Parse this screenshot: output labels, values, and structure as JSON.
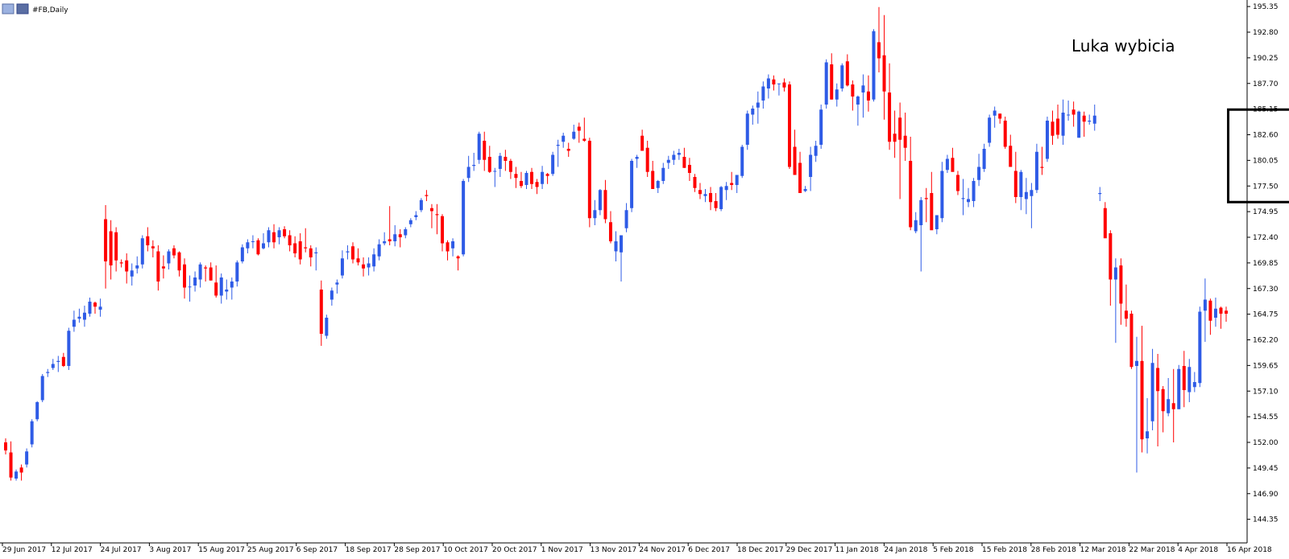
{
  "window": {
    "title": "#FB,Daily"
  },
  "colors": {
    "bull": "#2E5BE6",
    "bear": "#FF0000",
    "axis": "#000000",
    "highlight": "#000000"
  },
  "annotation": {
    "text": "Luka wybicia"
  },
  "chart_data": {
    "type": "candlestick",
    "symbol": "#FB",
    "timeframe": "Daily",
    "ylim": [
      142.0,
      196.0
    ],
    "y_ticks": [
      "195.35",
      "192.80",
      "190.25",
      "187.70",
      "185.15",
      "182.60",
      "180.05",
      "177.50",
      "174.95",
      "172.40",
      "169.85",
      "167.30",
      "164.75",
      "162.20",
      "159.65",
      "157.10",
      "154.55",
      "152.00",
      "149.45",
      "146.90",
      "144.35"
    ],
    "x_ticks": [
      "29 Jun 2017",
      "12 Jul 2017",
      "24 Jul 2017",
      "3 Aug 2017",
      "15 Aug 2017",
      "25 Aug 2017",
      "6 Sep 2017",
      "18 Sep 2017",
      "28 Sep 2017",
      "10 Oct 2017",
      "20 Oct 2017",
      "1 Nov 2017",
      "13 Nov 2017",
      "24 Nov 2017",
      "6 Dec 2017",
      "18 Dec 2017",
      "29 Dec 2017",
      "11 Jan 2018",
      "24 Jan 2018",
      "5 Feb 2018",
      "15 Feb 2018",
      "28 Feb 2018",
      "12 Mar 2018",
      "22 Mar 2018",
      "4 Apr 2018",
      "16 Apr 2018"
    ],
    "candles_ohlc": [
      [
        152.0,
        152.4,
        150.8,
        151.2
      ],
      [
        151.0,
        152.1,
        148.2,
        148.5
      ],
      [
        148.4,
        149.3,
        148.2,
        149.1
      ],
      [
        149.5,
        149.8,
        148.2,
        149.0
      ],
      [
        149.8,
        151.4,
        149.5,
        151.1
      ],
      [
        151.8,
        154.3,
        151.5,
        154.1
      ],
      [
        154.3,
        156.1,
        154.1,
        156.0
      ],
      [
        156.2,
        158.8,
        156.0,
        158.6
      ],
      [
        158.9,
        159.3,
        158.5,
        159.0
      ],
      [
        159.4,
        160.3,
        159.2,
        159.8
      ],
      [
        160.0,
        160.6,
        159.0,
        160.1
      ],
      [
        160.5,
        160.9,
        159.5,
        159.6
      ],
      [
        159.6,
        163.4,
        159.2,
        163.1
      ],
      [
        163.5,
        165.1,
        163.0,
        164.2
      ],
      [
        164.3,
        165.3,
        163.9,
        164.5
      ],
      [
        164.2,
        165.6,
        163.5,
        164.9
      ],
      [
        164.8,
        166.4,
        164.5,
        166.0
      ],
      [
        165.9,
        166.0,
        164.8,
        165.5
      ],
      [
        165.2,
        166.3,
        164.5,
        165.5
      ],
      [
        174.2,
        175.6,
        167.3,
        170.0
      ],
      [
        173.0,
        174.1,
        168.2,
        169.6
      ],
      [
        172.9,
        173.4,
        169.0,
        170.1
      ],
      [
        169.9,
        170.2,
        169.4,
        169.8
      ],
      [
        170.1,
        170.8,
        167.8,
        169.0
      ],
      [
        168.5,
        169.8,
        167.6,
        169.1
      ],
      [
        169.3,
        170.5,
        168.8,
        169.6
      ],
      [
        169.7,
        172.6,
        169.3,
        172.3
      ],
      [
        172.5,
        173.4,
        171.0,
        171.6
      ],
      [
        171.5,
        172.1,
        170.4,
        171.3
      ],
      [
        171.0,
        171.6,
        167.1,
        168.0
      ],
      [
        169.5,
        170.6,
        168.3,
        169.3
      ],
      [
        169.8,
        171.2,
        169.2,
        171.0
      ],
      [
        171.3,
        171.6,
        170.3,
        170.6
      ],
      [
        170.9,
        171.0,
        168.5,
        169.1
      ],
      [
        169.7,
        170.3,
        166.3,
        167.4
      ],
      [
        167.5,
        168.6,
        166.0,
        167.5
      ],
      [
        167.6,
        169.0,
        167.0,
        168.4
      ],
      [
        168.2,
        169.9,
        167.4,
        169.7
      ],
      [
        169.4,
        169.6,
        168.0,
        169.3
      ],
      [
        169.4,
        169.9,
        168.1,
        168.1
      ],
      [
        167.9,
        169.6,
        166.4,
        166.6
      ],
      [
        166.6,
        168.8,
        165.8,
        168.4
      ],
      [
        167.0,
        168.2,
        166.2,
        167.2
      ],
      [
        167.4,
        168.4,
        166.2,
        168.0
      ],
      [
        168.0,
        170.1,
        167.5,
        169.9
      ],
      [
        170.0,
        171.7,
        169.8,
        171.4
      ],
      [
        171.3,
        172.2,
        170.8,
        171.9
      ],
      [
        172.0,
        172.6,
        171.3,
        172.0
      ],
      [
        172.1,
        172.3,
        170.6,
        170.7
      ],
      [
        171.3,
        172.8,
        171.2,
        171.8
      ],
      [
        171.9,
        173.4,
        171.4,
        173.1
      ],
      [
        172.9,
        173.7,
        171.3,
        171.9
      ],
      [
        172.4,
        173.4,
        171.7,
        173.1
      ],
      [
        173.2,
        173.5,
        172.3,
        172.5
      ],
      [
        172.6,
        173.1,
        171.0,
        171.6
      ],
      [
        171.8,
        172.5,
        170.4,
        170.8
      ],
      [
        172.0,
        172.8,
        169.7,
        170.2
      ],
      [
        171.4,
        173.3,
        170.9,
        171.3
      ],
      [
        171.3,
        171.6,
        169.5,
        170.4
      ],
      [
        170.8,
        171.4,
        169.1,
        170.9
      ],
      [
        167.2,
        168.1,
        161.6,
        162.8
      ],
      [
        162.6,
        164.7,
        162.3,
        164.4
      ],
      [
        166.2,
        167.4,
        165.6,
        167.1
      ],
      [
        167.7,
        168.2,
        166.8,
        167.9
      ],
      [
        168.6,
        171.1,
        168.3,
        170.3
      ],
      [
        170.9,
        171.6,
        170.2,
        171.0
      ],
      [
        171.5,
        171.9,
        169.8,
        170.2
      ],
      [
        170.3,
        171.3,
        169.6,
        169.9
      ],
      [
        169.7,
        170.4,
        168.5,
        169.3
      ],
      [
        169.4,
        170.4,
        168.6,
        169.8
      ],
      [
        169.5,
        171.3,
        169.0,
        170.7
      ],
      [
        170.5,
        172.2,
        170.1,
        171.7
      ],
      [
        171.8,
        172.9,
        171.6,
        172.0
      ],
      [
        172.2,
        175.5,
        171.6,
        172.0
      ],
      [
        172.0,
        173.6,
        171.5,
        172.7
      ],
      [
        172.7,
        173.2,
        171.4,
        172.4
      ],
      [
        172.6,
        173.4,
        172.3,
        173.2
      ],
      [
        173.7,
        174.3,
        173.4,
        174.1
      ],
      [
        174.4,
        175.0,
        174.1,
        174.6
      ],
      [
        175.1,
        176.3,
        174.9,
        176.1
      ],
      [
        176.6,
        177.1,
        176.0,
        176.5
      ],
      [
        175.3,
        175.7,
        173.3,
        175.0
      ],
      [
        174.7,
        175.7,
        172.7,
        174.6
      ],
      [
        174.5,
        174.7,
        171.0,
        171.8
      ],
      [
        171.9,
        172.1,
        170.1,
        171.0
      ],
      [
        171.3,
        172.3,
        170.5,
        172.0
      ],
      [
        170.5,
        170.6,
        169.1,
        170.3
      ],
      [
        170.7,
        178.2,
        170.5,
        178.0
      ],
      [
        178.3,
        180.5,
        177.9,
        179.4
      ],
      [
        179.5,
        180.8,
        179.0,
        179.6
      ],
      [
        180.1,
        182.9,
        179.7,
        182.7
      ],
      [
        182.0,
        182.9,
        179.0,
        180.1
      ],
      [
        180.4,
        181.5,
        178.8,
        178.9
      ],
      [
        179.0,
        179.3,
        177.4,
        179.0
      ],
      [
        179.2,
        180.8,
        178.4,
        180.5
      ],
      [
        180.4,
        181.1,
        179.0,
        180.0
      ],
      [
        180.0,
        180.2,
        178.2,
        178.9
      ],
      [
        178.7,
        179.4,
        177.3,
        178.3
      ],
      [
        178.0,
        178.9,
        177.3,
        177.5
      ],
      [
        177.6,
        179.0,
        177.2,
        178.8
      ],
      [
        178.9,
        179.3,
        177.2,
        177.7
      ],
      [
        177.9,
        178.2,
        176.7,
        177.4
      ],
      [
        177.7,
        179.5,
        177.2,
        178.9
      ],
      [
        178.7,
        178.8,
        177.7,
        178.5
      ],
      [
        178.7,
        180.9,
        178.5,
        180.6
      ],
      [
        181.5,
        182.1,
        179.4,
        181.6
      ],
      [
        181.9,
        182.8,
        181.3,
        182.5
      ],
      [
        181.2,
        181.8,
        180.4,
        181.0
      ],
      [
        182.2,
        183.6,
        182.1,
        182.9
      ],
      [
        183.4,
        183.8,
        181.8,
        183.0
      ],
      [
        182.2,
        184.3,
        181.9,
        182.0
      ],
      [
        182.0,
        182.3,
        173.4,
        174.3
      ],
      [
        174.3,
        176.1,
        173.6,
        175.1
      ],
      [
        175.1,
        177.2,
        174.6,
        177.1
      ],
      [
        177.1,
        178.1,
        173.8,
        174.2
      ],
      [
        173.9,
        175.0,
        171.8,
        172.0
      ],
      [
        171.0,
        173.0,
        170.0,
        172.0
      ],
      [
        170.9,
        171.1,
        168.0,
        172.6
      ],
      [
        173.3,
        175.8,
        172.9,
        175.1
      ],
      [
        175.3,
        180.2,
        174.9,
        180.0
      ],
      [
        180.2,
        180.6,
        179.3,
        180.4
      ],
      [
        182.5,
        183.1,
        181.3,
        181.0
      ],
      [
        181.3,
        182.0,
        178.4,
        178.9
      ],
      [
        179.0,
        180.0,
        177.4,
        177.2
      ],
      [
        177.3,
        178.1,
        176.8,
        178.0
      ],
      [
        178.0,
        179.8,
        177.7,
        179.3
      ],
      [
        179.8,
        180.5,
        179.2,
        180.1
      ],
      [
        180.1,
        181.0,
        179.6,
        180.6
      ],
      [
        180.6,
        181.2,
        180.1,
        180.8
      ],
      [
        180.4,
        181.3,
        179.3,
        179.3
      ],
      [
        179.6,
        180.3,
        178.0,
        178.8
      ],
      [
        178.4,
        178.7,
        176.9,
        177.3
      ],
      [
        177.1,
        177.8,
        176.2,
        176.7
      ],
      [
        176.5,
        177.2,
        175.9,
        176.7
      ],
      [
        176.8,
        177.4,
        175.1,
        175.9
      ],
      [
        176.0,
        176.8,
        175.0,
        175.3
      ],
      [
        175.2,
        177.5,
        175.0,
        177.4
      ],
      [
        177.1,
        177.9,
        176.1,
        177.5
      ],
      [
        177.8,
        178.9,
        177.1,
        177.6
      ],
      [
        177.6,
        178.6,
        176.8,
        178.6
      ],
      [
        178.5,
        181.6,
        178.3,
        181.4
      ],
      [
        181.6,
        185.0,
        181.1,
        184.7
      ],
      [
        184.6,
        185.5,
        183.6,
        185.2
      ],
      [
        185.3,
        186.9,
        183.7,
        185.8
      ],
      [
        186.0,
        187.9,
        185.2,
        187.4
      ],
      [
        187.2,
        188.6,
        186.2,
        188.2
      ],
      [
        188.1,
        188.5,
        187.0,
        187.6
      ],
      [
        187.7,
        187.7,
        186.5,
        187.7
      ],
      [
        187.8,
        188.2,
        186.9,
        187.3
      ],
      [
        187.6,
        187.9,
        179.2,
        179.4
      ],
      [
        181.4,
        183.1,
        180.3,
        178.6
      ],
      [
        179.8,
        180.9,
        178.4,
        176.8
      ],
      [
        177.0,
        177.5,
        176.9,
        177.2
      ],
      [
        178.4,
        181.4,
        177.0,
        180.6
      ],
      [
        180.5,
        182.0,
        179.9,
        181.5
      ],
      [
        181.6,
        185.6,
        181.2,
        185.1
      ],
      [
        185.6,
        190.1,
        185.2,
        189.8
      ],
      [
        189.6,
        190.7,
        186.1,
        186.1
      ],
      [
        186.1,
        187.7,
        185.4,
        187.1
      ],
      [
        187.2,
        189.7,
        186.9,
        189.5
      ],
      [
        189.9,
        190.6,
        187.4,
        187.5
      ],
      [
        187.6,
        188.0,
        185.0,
        186.4
      ],
      [
        185.6,
        186.5,
        183.5,
        186.4
      ],
      [
        186.8,
        188.6,
        184.3,
        187.5
      ],
      [
        186.9,
        188.5,
        184.9,
        186.0
      ],
      [
        186.1,
        193.1,
        185.9,
        192.9
      ],
      [
        191.8,
        195.3,
        188.8,
        190.2
      ],
      [
        190.5,
        194.5,
        184.1,
        186.9
      ],
      [
        186.8,
        189.7,
        181.1,
        181.9
      ],
      [
        182.7,
        185.0,
        180.3,
        181.9
      ],
      [
        184.3,
        185.8,
        176.2,
        182.1
      ],
      [
        182.5,
        184.8,
        180.0,
        181.3
      ],
      [
        180.0,
        182.4,
        173.1,
        173.4
      ],
      [
        173.0,
        174.9,
        172.8,
        174.1
      ],
      [
        173.6,
        176.4,
        169.0,
        176.1
      ],
      [
        176.3,
        177.3,
        173.9,
        176.2
      ],
      [
        176.8,
        178.9,
        175.6,
        173.1
      ],
      [
        173.2,
        174.5,
        172.7,
        174.6
      ],
      [
        174.3,
        179.9,
        173.9,
        179.0
      ],
      [
        179.1,
        180.6,
        178.8,
        180.2
      ],
      [
        180.3,
        181.3,
        179.7,
        178.9
      ],
      [
        178.6,
        179.0,
        176.6,
        177.0
      ],
      [
        176.2,
        178.2,
        174.6,
        176.3
      ],
      [
        175.9,
        177.3,
        175.4,
        176.2
      ],
      [
        176.0,
        178.3,
        175.4,
        178.0
      ],
      [
        178.1,
        180.7,
        177.5,
        179.4
      ],
      [
        179.2,
        181.7,
        178.9,
        181.2
      ],
      [
        181.8,
        184.6,
        181.4,
        184.3
      ],
      [
        184.5,
        185.4,
        183.3,
        185.0
      ],
      [
        184.7,
        184.7,
        183.7,
        184.2
      ],
      [
        184.0,
        184.4,
        181.2,
        181.4
      ],
      [
        181.5,
        182.6,
        180.2,
        179.4
      ],
      [
        179.0,
        180.9,
        175.8,
        176.4
      ],
      [
        176.4,
        179.1,
        175.1,
        178.9
      ],
      [
        176.2,
        178.3,
        174.7,
        176.9
      ],
      [
        176.5,
        177.8,
        173.3,
        177.1
      ],
      [
        177.1,
        181.7,
        176.8,
        180.9
      ],
      [
        179.4,
        181.4,
        178.6,
        179.3
      ],
      [
        180.2,
        184.4,
        179.9,
        184.0
      ],
      [
        183.9,
        185.0,
        181.6,
        182.5
      ],
      [
        184.2,
        185.6,
        182.2,
        182.6
      ],
      [
        182.5,
        186.1,
        181.6,
        184.8
      ],
      [
        184.6,
        186.0,
        184.0,
        184.6
      ],
      [
        185.1,
        185.9,
        183.4,
        184.6
      ],
      [
        182.3,
        185.0,
        182.3,
        184.9
      ],
      [
        184.5,
        184.9,
        182.4,
        183.9
      ],
      [
        183.9,
        184.6,
        183.6,
        184.0
      ],
      [
        183.7,
        185.6,
        183.0,
        184.5
      ],
      [
        176.7,
        177.4,
        176.0,
        176.8
      ],
      [
        175.3,
        175.9,
        172.6,
        172.3
      ],
      [
        172.8,
        173.1,
        165.6,
        168.2
      ],
      [
        168.2,
        170.3,
        161.9,
        169.4
      ],
      [
        169.6,
        170.3,
        163.7,
        165.8
      ],
      [
        165.1,
        167.7,
        163.5,
        164.3
      ],
      [
        164.8,
        165.1,
        159.3,
        159.5
      ],
      [
        159.6,
        162.5,
        149.0,
        160.1
      ],
      [
        160.1,
        163.6,
        151.0,
        152.3
      ],
      [
        152.4,
        156.4,
        150.9,
        153.1
      ],
      [
        154.1,
        161.3,
        153.2,
        159.9
      ],
      [
        159.4,
        160.8,
        151.6,
        157.1
      ],
      [
        157.3,
        157.6,
        153.0,
        155.1
      ],
      [
        154.9,
        158.4,
        154.6,
        156.3
      ],
      [
        155.9,
        159.3,
        152.0,
        155.3
      ],
      [
        155.3,
        159.7,
        155.3,
        159.3
      ],
      [
        159.6,
        161.1,
        155.5,
        157.2
      ],
      [
        157.0,
        160.3,
        156.0,
        159.5
      ],
      [
        157.5,
        159.0,
        157.0,
        158.0
      ],
      [
        157.9,
        165.5,
        157.5,
        165.0
      ],
      [
        165.1,
        168.3,
        162.0,
        166.2
      ],
      [
        166.1,
        166.3,
        162.7,
        164.1
      ],
      [
        164.4,
        166.4,
        163.5,
        165.3
      ],
      [
        165.4,
        165.5,
        163.3,
        164.8
      ],
      [
        165.1,
        165.5,
        164.0,
        164.8
      ]
    ],
    "annotation_box": {
      "label": "Luka wybicia",
      "price_top": 185.1,
      "price_bottom": 175.9,
      "from_candle": 233,
      "to_candle": 244
    }
  }
}
